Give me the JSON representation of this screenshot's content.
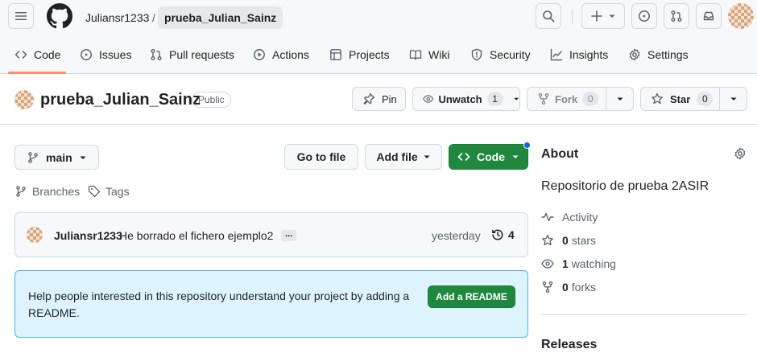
{
  "header": {
    "owner": "Juliansr1233",
    "separator": "/",
    "repo": "prueba_Julian_Sainz"
  },
  "nav": {
    "tabs": [
      {
        "label": "Code",
        "icon": "code-icon"
      },
      {
        "label": "Issues",
        "icon": "issue-icon"
      },
      {
        "label": "Pull requests",
        "icon": "pull-request-icon"
      },
      {
        "label": "Actions",
        "icon": "play-icon"
      },
      {
        "label": "Projects",
        "icon": "table-icon"
      },
      {
        "label": "Wiki",
        "icon": "book-icon"
      },
      {
        "label": "Security",
        "icon": "shield-icon"
      },
      {
        "label": "Insights",
        "icon": "graph-icon"
      },
      {
        "label": "Settings",
        "icon": "gear-icon"
      }
    ]
  },
  "repo_header": {
    "name": "prueba_Julian_Sainz",
    "visibility": "Public",
    "pin_label": "Pin",
    "unwatch_label": "Unwatch",
    "unwatch_count": "1",
    "fork_label": "Fork",
    "fork_count": "0",
    "star_label": "Star",
    "star_count": "0"
  },
  "toolbar": {
    "branch": "main",
    "go_to_file": "Go to file",
    "add_file": "Add file",
    "code": "Code",
    "branches": "Branches",
    "tags": "Tags"
  },
  "commit": {
    "author": "Juliansr1233",
    "message": "He borrado el fichero ejemplo2",
    "ellipsis": "...",
    "time": "yesterday",
    "count": "4"
  },
  "readme_banner": {
    "text": "Help people interested in this repository understand your project by adding a README.",
    "button": "Add a README"
  },
  "about": {
    "title": "About",
    "description": "Repositorio de prueba 2ASIR",
    "activity": "Activity",
    "stars_count": "0",
    "stars_label": "stars",
    "watching_count": "1",
    "watching_label": "watching",
    "forks_count": "0",
    "forks_label": "forks",
    "releases": "Releases"
  },
  "colors": {
    "primary_green": "#1f883d",
    "banner_bg": "#ddf4ff",
    "banner_border": "#54aeff",
    "tab_underline": "#fd8c73",
    "notification_dot": "#0969da"
  }
}
